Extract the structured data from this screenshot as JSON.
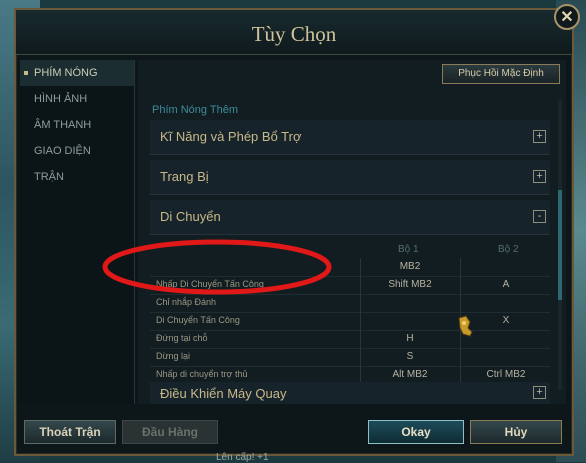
{
  "window": {
    "title": "Tùy Chọn",
    "close_glyph": "✕"
  },
  "sidebar": {
    "items": [
      {
        "label": "PHÍM NÓNG",
        "active": true
      },
      {
        "label": "HÌNH ẢNH",
        "active": false
      },
      {
        "label": "ÂM THANH",
        "active": false
      },
      {
        "label": "GIAO DIỆN",
        "active": false
      },
      {
        "label": "TRẬN",
        "active": false
      }
    ]
  },
  "content": {
    "restore_label": "Phục Hồi Mặc Định",
    "section_title": "Phím Nóng Thêm",
    "categories": {
      "skills": {
        "label": "Kĩ Năng và Phép Bổ Trợ",
        "toggle": "+"
      },
      "items": {
        "label": "Trang Bị",
        "toggle": "+"
      },
      "movement": {
        "label": "Di Chuyển",
        "toggle": "-"
      },
      "camera": {
        "label": "Điều Khiển Máy Quay",
        "toggle": "+"
      }
    },
    "columns": {
      "set1": "Bộ 1",
      "set2": "Bộ 2"
    },
    "movement_rows": [
      {
        "name": "",
        "set1": "MB2",
        "set2": ""
      },
      {
        "name": "Nhấp Di Chuyển Tấn Công",
        "set1": "Shift  MB2",
        "set2": "A"
      },
      {
        "name": "Chỉ nhắp Đánh",
        "set1": "",
        "set2": ""
      },
      {
        "name": "Di Chuyển Tấn Công",
        "set1": "",
        "set2": "X"
      },
      {
        "name": "Đứng tại chỗ",
        "set1": "H",
        "set2": ""
      },
      {
        "name": "Dừng lại",
        "set1": "S",
        "set2": ""
      },
      {
        "name": "Nhấp di chuyển trợ thủ",
        "set1": "Alt  MB2",
        "set2": "Ctrl  MB2"
      }
    ]
  },
  "footer": {
    "leave_label": "Thoát Trận",
    "surrender_label": "Đầu Hàng",
    "ok_label": "Okay",
    "cancel_label": "Hủy"
  },
  "background": {
    "level_text": "Lên cấp! +1"
  },
  "colors": {
    "accent": "#3e8c9a",
    "gold": "#c8b98a",
    "annotation": "#e01818"
  }
}
